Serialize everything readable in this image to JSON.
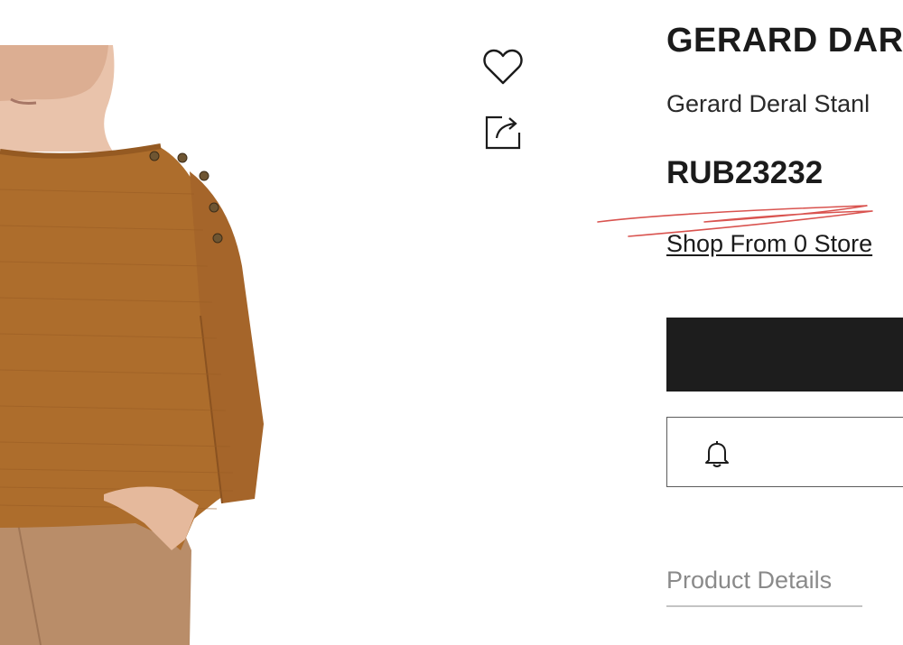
{
  "product": {
    "brand": "GERARD DAR",
    "name": "Gerard Deral Stanl",
    "price": "RUB23232",
    "shop_link": "Shop From 0 Store"
  },
  "actions": {
    "wishlist_icon": "heart-icon",
    "share_icon": "share-icon"
  },
  "buttons": {
    "primary_color": "#1d1d1d",
    "notify_icon": "bell-icon"
  },
  "tabs": {
    "details_label": "Product Details"
  },
  "annotation": {
    "scribble_color": "#d9534f"
  }
}
